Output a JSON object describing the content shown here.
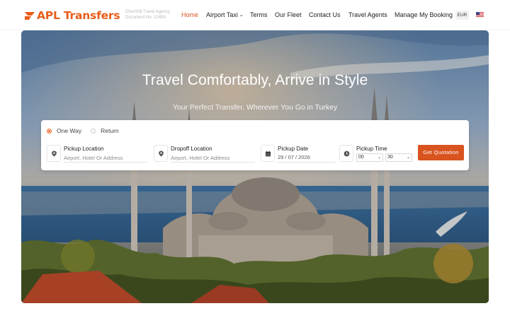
{
  "header": {
    "brand": "APL Transfers",
    "agency_line1": "Churchill Travel Agency",
    "agency_line2": "Document No: 12459",
    "nav": {
      "home": "Home",
      "airport_taxi": "Airport Taxi",
      "terms": "Terms",
      "fleet": "Our Fleet",
      "contact": "Contact Us",
      "agents": "Travel Agents",
      "booking": "Manage My Booking"
    },
    "currency": "EUR",
    "language_flag": "us-flag-icon"
  },
  "hero": {
    "title": "Travel Comfortably, Arrive in Style",
    "subtitle": "Your Perfect Transfer, Wherever You Go in Turkey"
  },
  "form": {
    "trip_type": {
      "options": [
        "One Way",
        "Return"
      ],
      "selected": "One Way"
    },
    "pickup": {
      "label": "Pickup Location",
      "placeholder": "Airport, Hotel Or Address"
    },
    "dropoff": {
      "label": "Dropoff Location",
      "placeholder": "Airport, Hotel Or Address"
    },
    "date": {
      "label": "Pickup Date",
      "value": "29 / 07 / 2026"
    },
    "time": {
      "label": "Pickup Time",
      "hour": "00",
      "minute": "30"
    },
    "submit": "Get Quotation"
  },
  "colors": {
    "accent": "#d9531e",
    "brand": "#e85d1a"
  }
}
